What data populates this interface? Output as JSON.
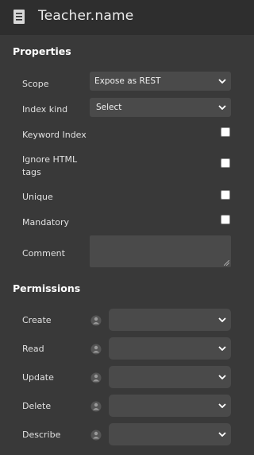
{
  "header": {
    "title": "Teacher.name",
    "icon": "document-icon"
  },
  "properties": {
    "section_title": "Properties",
    "scope": {
      "label": "Scope",
      "value": "Expose as REST"
    },
    "index_kind": {
      "label": "Index kind",
      "value": "Select"
    },
    "keyword_index": {
      "label": "Keyword Index",
      "checked": false
    },
    "ignore_html": {
      "label_line1": "Ignore HTML",
      "label_line2": "tags",
      "checked": false
    },
    "unique": {
      "label": "Unique",
      "checked": false
    },
    "mandatory": {
      "label": "Mandatory",
      "checked": false
    },
    "comment": {
      "label": "Comment",
      "value": ""
    }
  },
  "permissions": {
    "section_title": "Permissions",
    "items": [
      {
        "label": "Create",
        "value": ""
      },
      {
        "label": "Read",
        "value": ""
      },
      {
        "label": "Update",
        "value": ""
      },
      {
        "label": "Delete",
        "value": ""
      },
      {
        "label": "Describe",
        "value": ""
      }
    ]
  },
  "colors": {
    "background": "#393939",
    "header": "#2e2e2e",
    "field": "#4a4a4a"
  }
}
